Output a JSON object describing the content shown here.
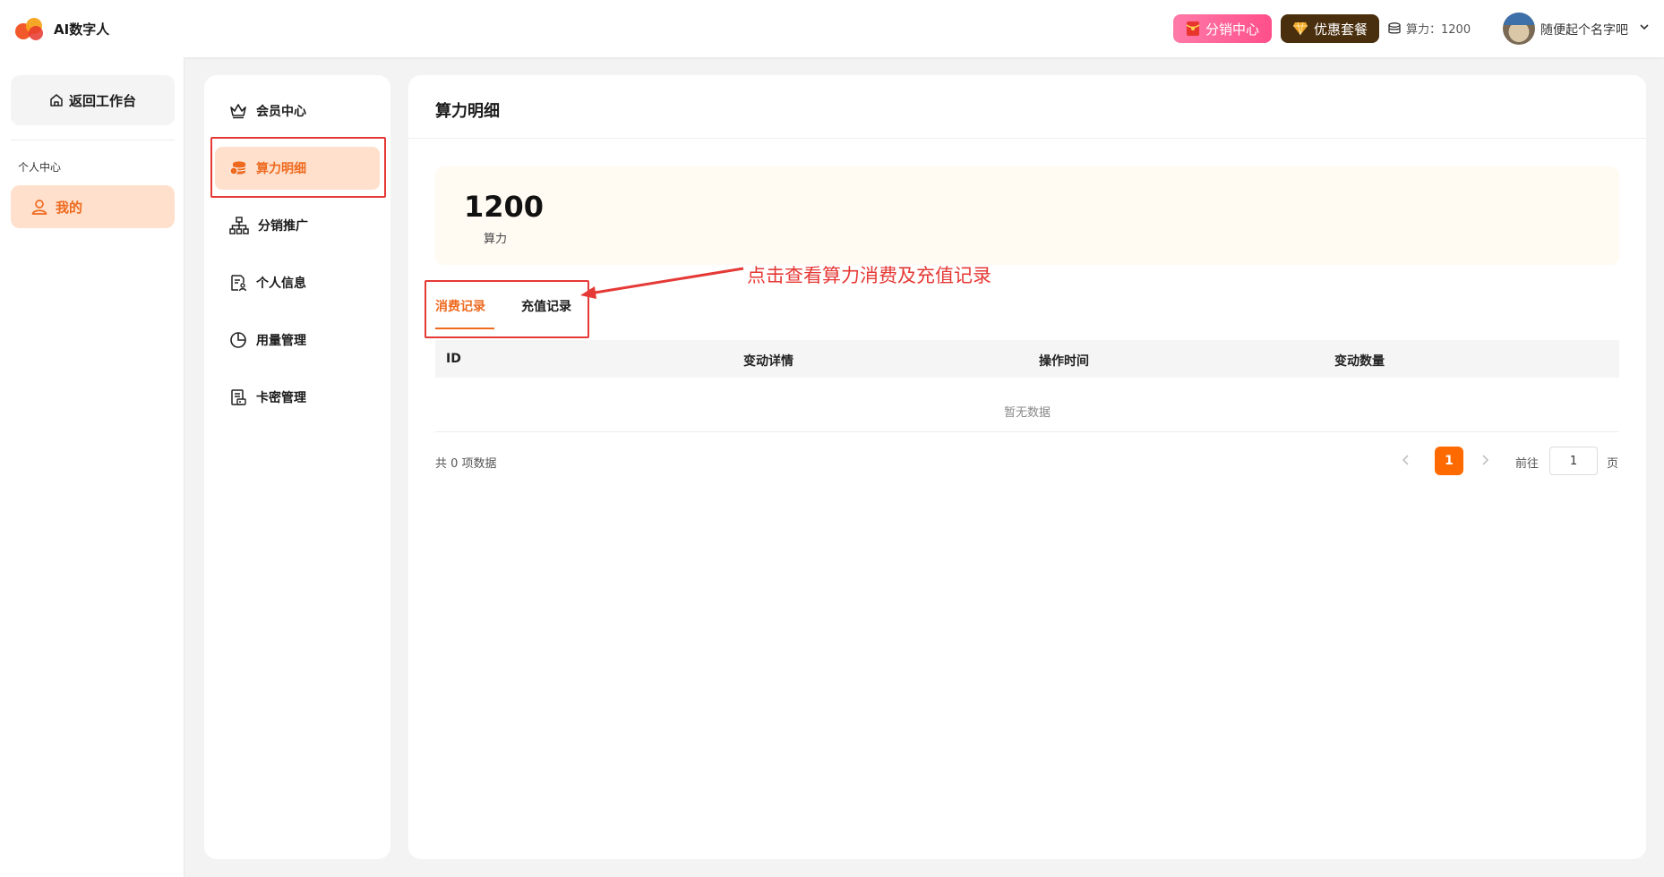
{
  "header": {
    "app_title": "AI数字人",
    "distribution_label": "分销中心",
    "plan_label": "优惠套餐",
    "power_text": "算力：1200",
    "user_name": "随便起个名字吧"
  },
  "sidebar": {
    "back_label": "返回工作台",
    "section_label": "个人中心",
    "my_label": "我的"
  },
  "menu": {
    "items": [
      {
        "label": "会员中心",
        "icon": "crown-icon"
      },
      {
        "label": "算力明细",
        "icon": "coins-icon"
      },
      {
        "label": "分销推广",
        "icon": "sitemap-icon"
      },
      {
        "label": "个人信息",
        "icon": "profile-doc-icon"
      },
      {
        "label": "用量管理",
        "icon": "pie-chart-icon"
      },
      {
        "label": "卡密管理",
        "icon": "card-key-icon"
      }
    ],
    "active_index": 1
  },
  "main": {
    "title": "算力明细",
    "balance_value": "1200",
    "balance_label": "算力",
    "annotation": "点击查看算力消费及充值记录",
    "tabs": [
      "消费记录",
      "充值记录"
    ],
    "table_headers": [
      "ID",
      "变动详情",
      "操作时间",
      "变动数量"
    ],
    "empty_text": "暂无数据",
    "total_text": "共 0 项数据",
    "current_page": "1",
    "goto_label": "前往",
    "goto_value": "1",
    "goto_suffix": "页"
  },
  "colors": {
    "accent": "#ee6a1f",
    "accent_light": "#ffe0cc",
    "page_active": "#ff6a00",
    "annotation_red": "#e53935",
    "plan_button": "#4a2f0e",
    "distribution_button": "#ff4f8b"
  }
}
